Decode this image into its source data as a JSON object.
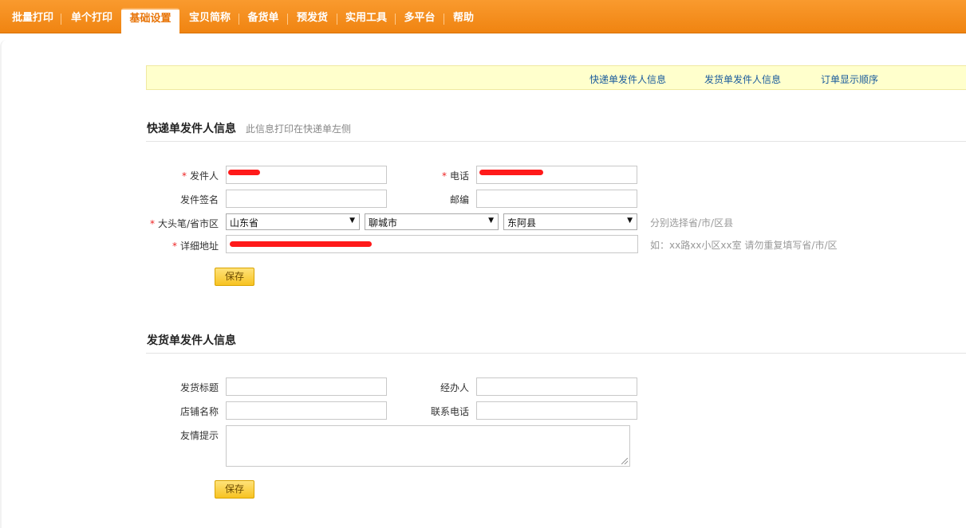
{
  "nav": {
    "tabs": [
      "批量打印",
      "单个打印",
      "基础设置",
      "宝贝简称",
      "备货单",
      "预发货",
      "实用工具",
      "多平台",
      "帮助"
    ],
    "active_index": 2
  },
  "anchors": [
    "快递单发件人信息",
    "发货单发件人信息",
    "订单显示顺序"
  ],
  "express": {
    "title": "快递单发件人信息",
    "hint": "此信息打印在快递单左侧",
    "sender_label": "发件人",
    "phone_label": "电话",
    "signature_label": "发件签名",
    "zip_label": "邮编",
    "region_label": "大头笔/省市区",
    "province": "山东省",
    "city": "聊城市",
    "district": "东阿县",
    "region_hint": "分别选择省/市/区县",
    "address_label": "详细地址",
    "address_hint": "如：xx路xx小区xx室 请勿重复填写省/市/区",
    "save": "保存",
    "required_mark": "*"
  },
  "shipping": {
    "title": "发货单发件人信息",
    "ship_title_label": "发货标题",
    "handler_label": "经办人",
    "shop_label": "店铺名称",
    "contact_label": "联系电话",
    "tip_label": "友情提示",
    "save": "保存"
  },
  "colors": {
    "nav_bg": "#f08411",
    "active_tab_text": "#e8760a",
    "link": "#1a5b9c",
    "required": "#e22222",
    "button_bg": "#f7c322"
  },
  "icons": {
    "select_arrow": "dropdown-arrow-icon"
  }
}
